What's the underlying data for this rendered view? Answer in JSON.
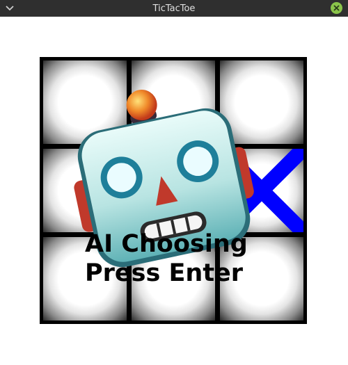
{
  "window": {
    "title": "TicTacToe"
  },
  "icons": {
    "menu": "chevron-down-icon",
    "close": "close-icon",
    "robot": "robot-icon"
  },
  "colors": {
    "titlebar": "#2f2f2f",
    "close_button": "#8ac44a",
    "x_mark": "#0000ff",
    "grid": "#000000"
  },
  "board": {
    "cells": [
      "",
      "",
      "",
      "",
      "",
      "X",
      "",
      "",
      ""
    ]
  },
  "status": {
    "line1": "AI Choosing",
    "line2": "Press Enter"
  }
}
